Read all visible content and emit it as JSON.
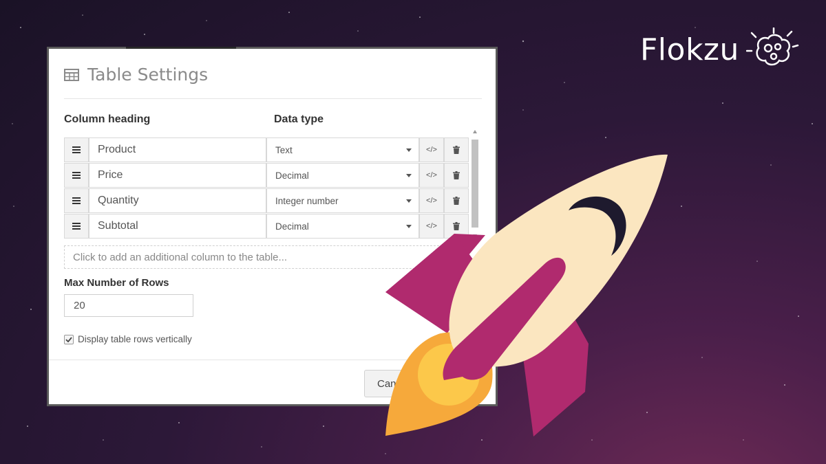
{
  "brand": {
    "name": "Flokzu"
  },
  "dialog": {
    "title": "Table Settings",
    "column_heading_label": "Column heading",
    "data_type_label": "Data type",
    "columns": [
      {
        "name": "Product",
        "type": "Text"
      },
      {
        "name": "Price",
        "type": "Decimal"
      },
      {
        "name": "Quantity",
        "type": "Integer number"
      },
      {
        "name": "Subtotal",
        "type": "Decimal"
      }
    ],
    "add_column_text": "Click to add an additional column to the table...",
    "max_rows_label": "Max Number of Rows",
    "max_rows_value": "20",
    "display_vertical_label": "Display table rows vertically",
    "display_vertical_checked": true,
    "cancel_label": "Can"
  },
  "colors": {
    "rocket_body": "#fbe6c0",
    "rocket_fins": "#b02a6e",
    "flame_outer": "#f6a93b",
    "flame_inner": "#fcc84a",
    "window": "#1e1a2e"
  },
  "icons": {
    "title": "table-icon",
    "handle": "drag-handle-icon",
    "code": "code-icon",
    "delete": "trash-icon",
    "brand": "brain-gears-icon"
  }
}
